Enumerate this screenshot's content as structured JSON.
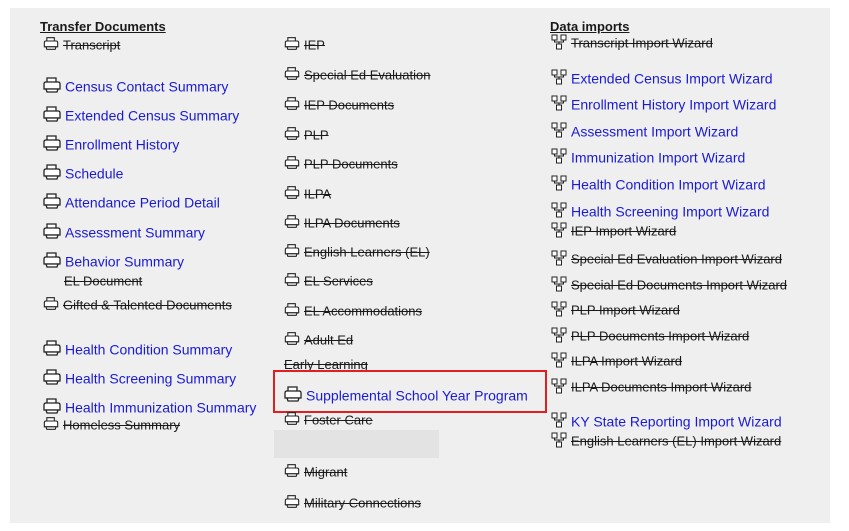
{
  "colors": {
    "link": "#1a1ad6",
    "disabled": "#1a1a1a",
    "highlight": "#e02020",
    "panel_bg": "#efefef"
  },
  "headings": {
    "transfer": "Transfer Documents",
    "imports": "Data imports",
    "early_learning": "Early Learning"
  },
  "col1": {
    "items": [
      {
        "label": "Transcript",
        "state": "disabled",
        "icon": "printer-icon"
      },
      {
        "label": "Census Contact Summary",
        "state": "active",
        "icon": "printer-icon"
      },
      {
        "label": "Extended Census Summary",
        "state": "active",
        "icon": "printer-icon"
      },
      {
        "label": "Enrollment History",
        "state": "active",
        "icon": "printer-icon"
      },
      {
        "label": "Schedule",
        "state": "active",
        "icon": "printer-icon"
      },
      {
        "label": "Attendance Period Detail",
        "state": "active",
        "icon": "printer-icon"
      },
      {
        "label": "Assessment Summary",
        "state": "active",
        "icon": "printer-icon"
      },
      {
        "label": "Behavior Summary",
        "state": "active",
        "icon": "printer-icon"
      },
      {
        "label": "EL Document",
        "state": "disabled",
        "icon": "none"
      },
      {
        "label": "Gifted & Talented Documents",
        "state": "disabled",
        "icon": "printer-icon"
      },
      {
        "label": "Health Condition Summary",
        "state": "active",
        "icon": "printer-icon"
      },
      {
        "label": "Health Screening Summary",
        "state": "active",
        "icon": "printer-icon"
      },
      {
        "label": "Health Immunization Summary",
        "state": "active",
        "icon": "printer-icon"
      },
      {
        "label": "Homeless Summary",
        "state": "disabled",
        "icon": "printer-icon"
      }
    ]
  },
  "col2": {
    "items": [
      {
        "label": "IEP",
        "state": "disabled"
      },
      {
        "label": "Special Ed Evaluation",
        "state": "disabled"
      },
      {
        "label": "IEP Documents",
        "state": "disabled"
      },
      {
        "label": "PLP",
        "state": "disabled"
      },
      {
        "label": "PLP Documents",
        "state": "disabled"
      },
      {
        "label": "ILPA",
        "state": "disabled"
      },
      {
        "label": "ILPA Documents",
        "state": "disabled"
      },
      {
        "label": "English Learners (EL)",
        "state": "disabled"
      },
      {
        "label": "EL Services",
        "state": "disabled"
      },
      {
        "label": "EL Accommodations",
        "state": "disabled"
      },
      {
        "label": "Adult Ed",
        "state": "disabled"
      },
      {
        "label": "Supplemental School Year Program",
        "state": "active"
      },
      {
        "label": "Foster Care",
        "state": "disabled"
      },
      {
        "label": "Migrant",
        "state": "disabled"
      },
      {
        "label": "Military Connections",
        "state": "disabled"
      }
    ]
  },
  "col3": {
    "items": [
      {
        "label": "Transcript Import Wizard",
        "state": "disabled"
      },
      {
        "label": "Extended Census Import Wizard",
        "state": "active"
      },
      {
        "label": "Enrollment History Import Wizard",
        "state": "active"
      },
      {
        "label": "Assessment Import Wizard",
        "state": "active"
      },
      {
        "label": "Immunization Import Wizard",
        "state": "active"
      },
      {
        "label": "Health Condition Import Wizard",
        "state": "active"
      },
      {
        "label": "Health Screening Import Wizard",
        "state": "active"
      },
      {
        "label": "IEP Import Wizard",
        "state": "disabled"
      },
      {
        "label": "Special Ed Evaluation Import Wizard",
        "state": "disabled"
      },
      {
        "label": "Special Ed Documents Import Wizard",
        "state": "disabled"
      },
      {
        "label": "PLP Import Wizard",
        "state": "disabled"
      },
      {
        "label": "PLP Documents Import Wizard",
        "state": "disabled"
      },
      {
        "label": "ILPA Import Wizard",
        "state": "disabled"
      },
      {
        "label": "ILPA Documents Import Wizard",
        "state": "disabled"
      },
      {
        "label": "KY State Reporting Import Wizard",
        "state": "active"
      },
      {
        "label": "English Learners (EL) Import Wizard",
        "state": "disabled"
      }
    ]
  }
}
